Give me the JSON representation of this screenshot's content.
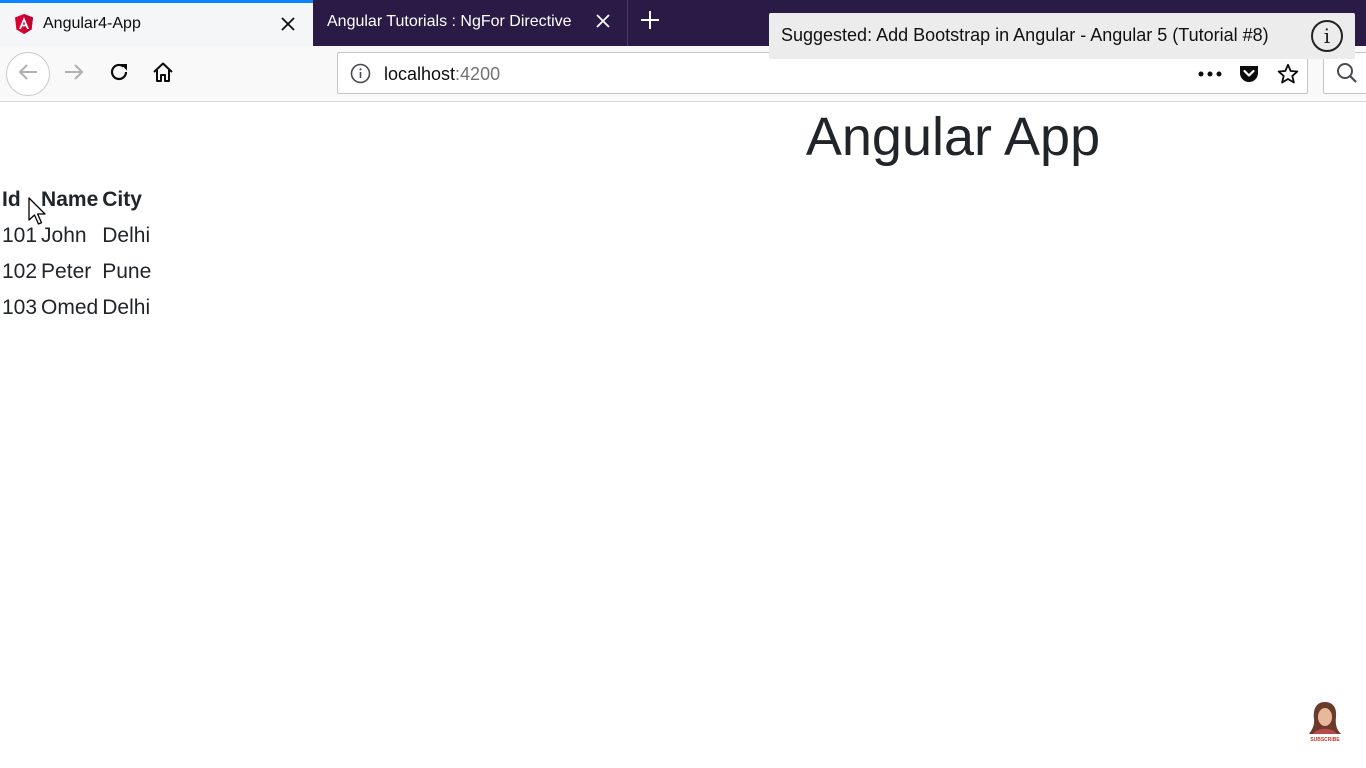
{
  "browser": {
    "tabs": [
      {
        "title": "Angular4-App",
        "active": true
      },
      {
        "title": "Angular Tutorials : NgFor Directive",
        "active": false
      }
    ],
    "url": {
      "host": "localhost",
      "port": ":4200"
    }
  },
  "overlay": {
    "suggested": "Suggested: Add Bootstrap in Angular - Angular 5 (Tutorial #8)",
    "info_glyph": "i"
  },
  "page": {
    "title": "Angular App",
    "table": {
      "headers": [
        "Id",
        "Name",
        "City"
      ],
      "rows": [
        [
          "101",
          "John",
          "Delhi"
        ],
        [
          "102",
          "Peter",
          "Pune"
        ],
        [
          "103",
          "Omed",
          "Delhi"
        ]
      ]
    }
  },
  "badge": {
    "text": "SUBSCRIBE"
  },
  "colors": {
    "tabstrip": "#2a1b46",
    "tab_active": "#f5f6f7",
    "tab_accent": "#0a84ff",
    "angular_red": "#dd0031"
  },
  "icons": [
    "angular-logo-icon",
    "close-icon",
    "plus-icon",
    "back-arrow-icon",
    "forward-arrow-icon",
    "reload-icon",
    "home-icon",
    "info-icon",
    "more-icon",
    "pocket-icon",
    "star-icon",
    "search-icon",
    "cursor-icon"
  ]
}
